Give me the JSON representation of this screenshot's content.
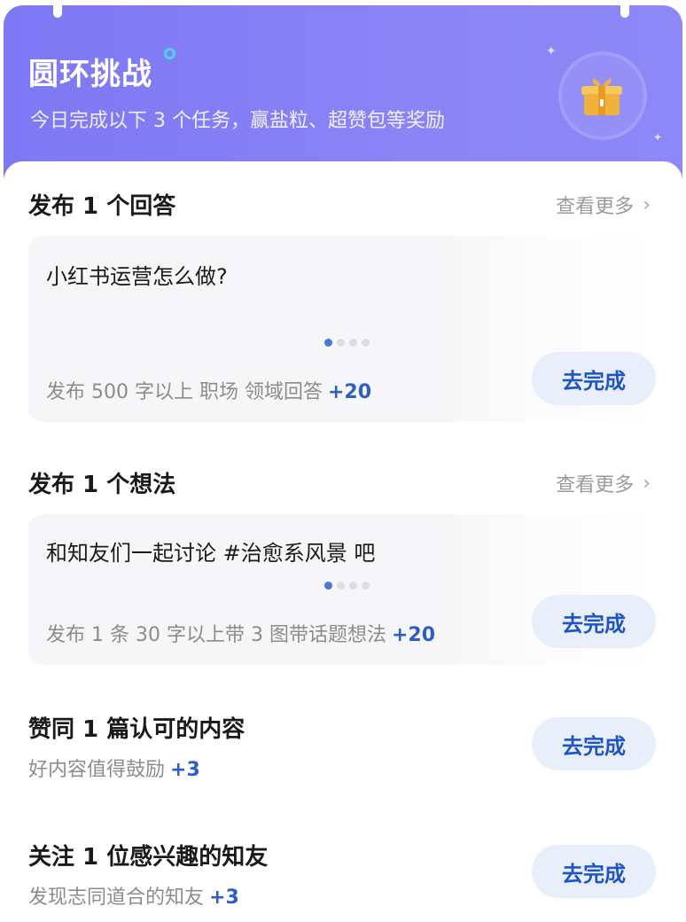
{
  "header": {
    "title": "圆环挑战",
    "subtitle": "今日完成以下 3 个任务，赢盐粒、超赞包等奖励"
  },
  "sections": [
    {
      "title": "发布 1 个回答",
      "more_label": "查看更多",
      "card": {
        "question": "小红书运营怎么做?",
        "description": "发布 500 字以上 职场 领域回答",
        "points": "+20",
        "button_label": "去完成"
      }
    },
    {
      "title": "发布 1 个想法",
      "more_label": "查看更多",
      "card": {
        "question": "和知友们一起讨论 #治愈系风景 吧",
        "description": "发布 1 条 30 字以上带 3 图带话题想法",
        "points": "+20",
        "button_label": "去完成"
      }
    }
  ],
  "tasks": [
    {
      "title": "赞同 1 篇认可的内容",
      "description": "好内容值得鼓励",
      "points": "+3",
      "button_label": "去完成"
    },
    {
      "title": "关注 1 位感兴趣的知友",
      "description": "发现志同道合的知友",
      "points": "+3",
      "button_label": "去完成"
    }
  ],
  "colors": {
    "header_bg": "#7d78f4",
    "accent_blue": "#2f5ec2",
    "button_bg": "#e8effb",
    "gift": "#f2b03c"
  },
  "icons": {
    "gift": "gift-box-icon",
    "more": "chevron-right-icon",
    "badge": "ring-dot-icon"
  }
}
